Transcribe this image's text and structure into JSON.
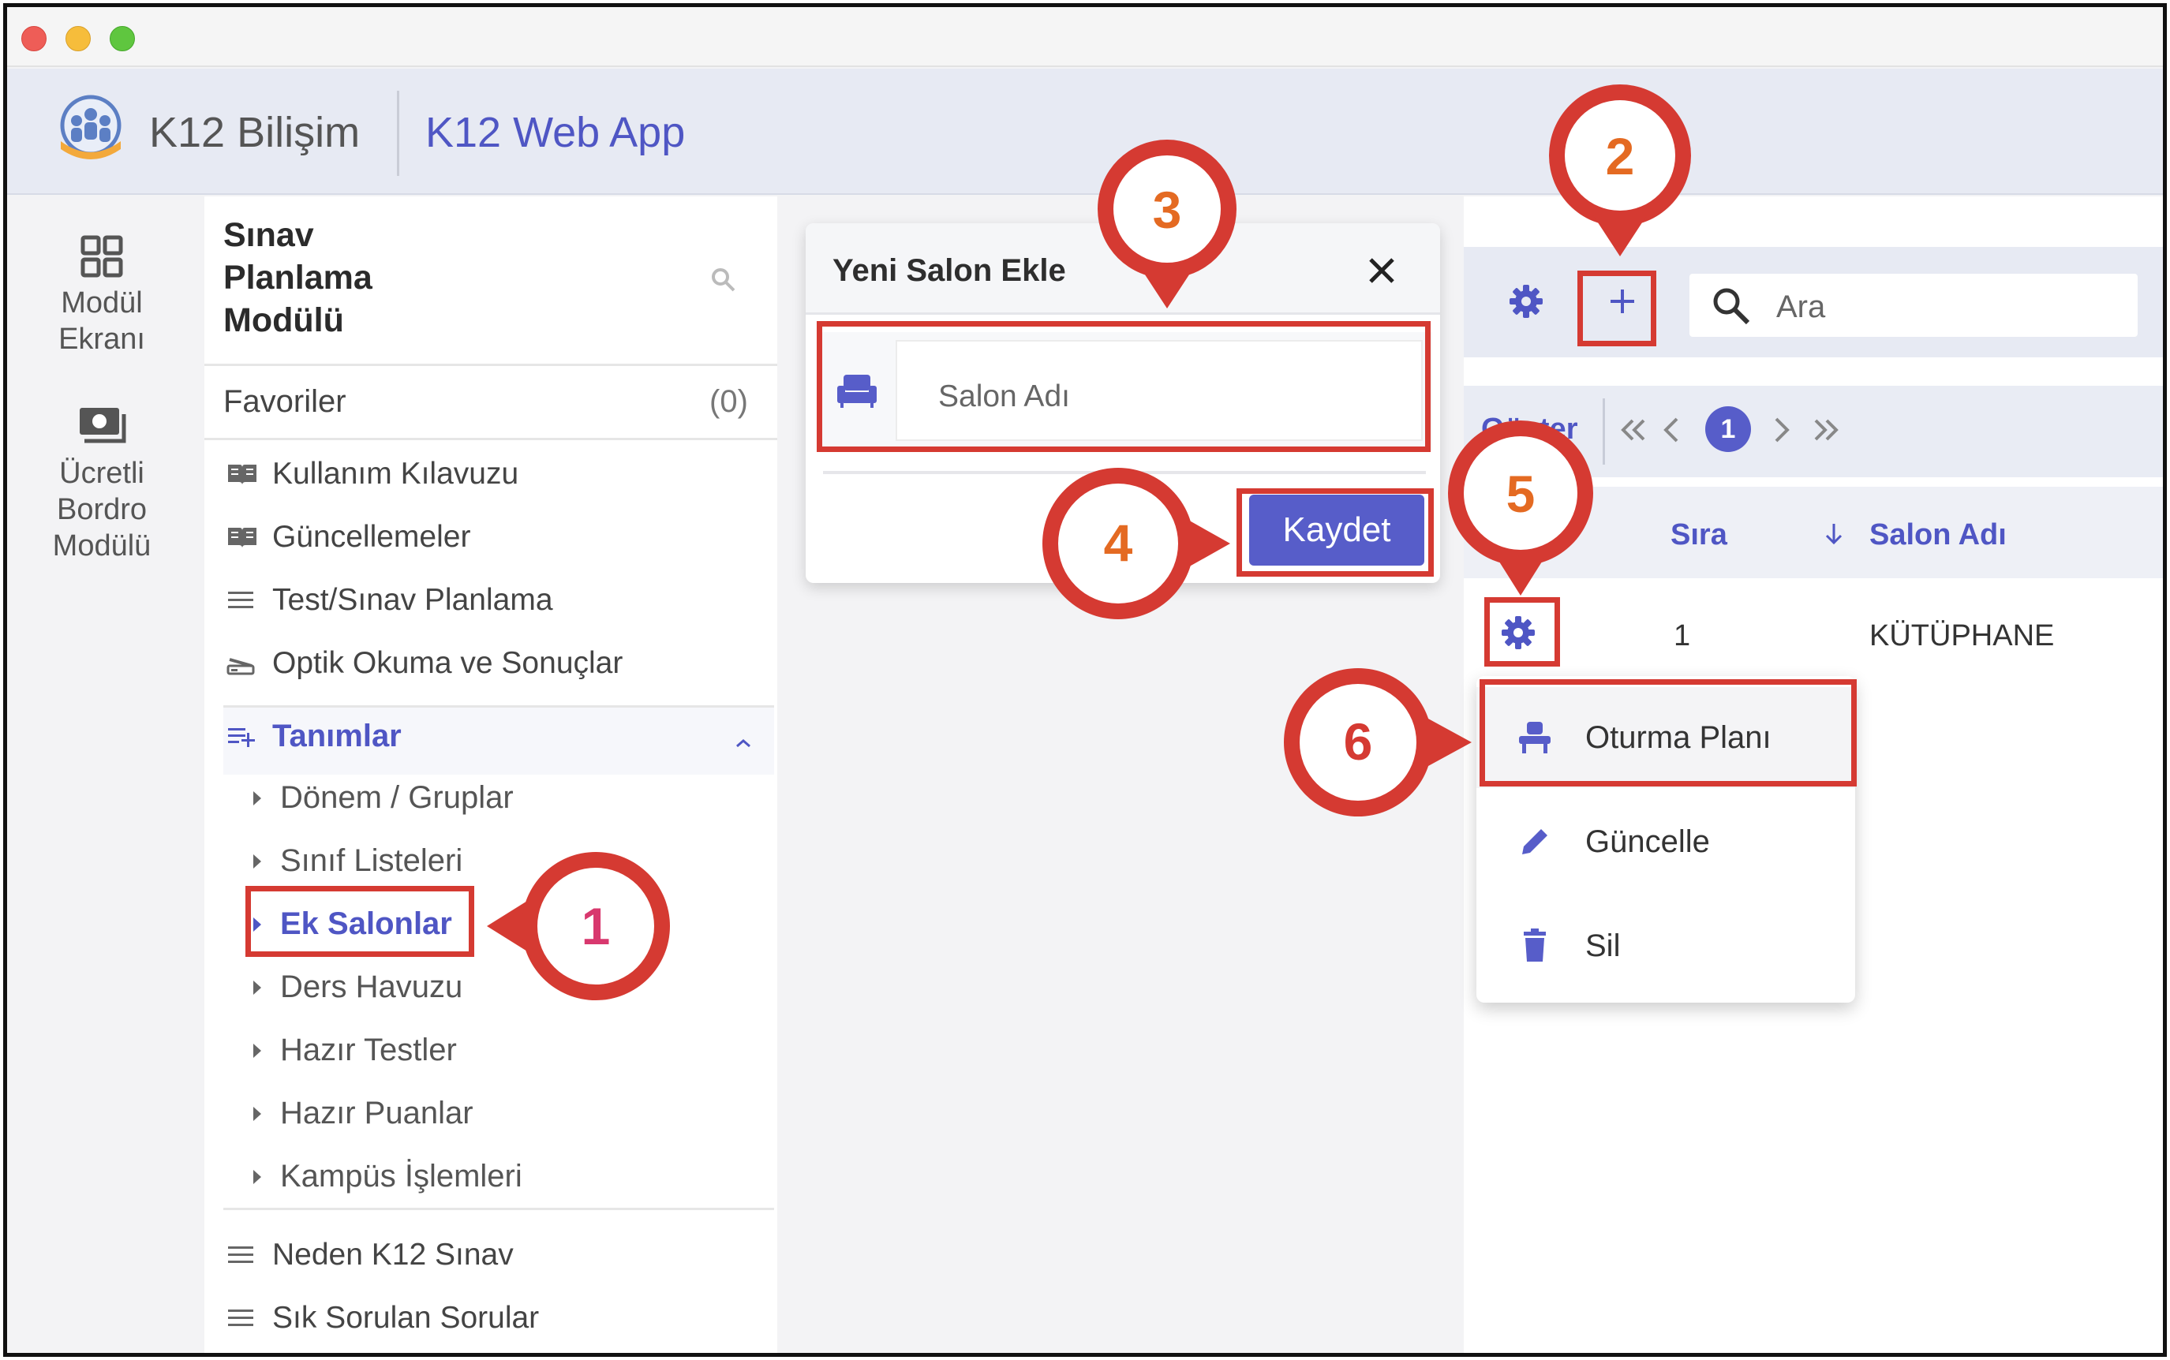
{
  "app": {
    "brand": "K12 Bilişim",
    "name": "K12 Web App"
  },
  "rail": {
    "items": [
      {
        "label_line1": "Modül",
        "label_line2": "Ekranı",
        "icon": "grid-icon"
      },
      {
        "label_line1": "Ücretli",
        "label_line2": "Bordro",
        "label_line3": "Modülü",
        "icon": "payroll-icon"
      }
    ]
  },
  "nav": {
    "title_line1": "Sınav",
    "title_line2": "Planlama",
    "title_line3": "Modülü",
    "favorites_label": "Favoriler",
    "favorites_count": "(0)",
    "items": [
      {
        "label": "Kullanım Kılavuzu",
        "icon": "book-icon"
      },
      {
        "label": "Güncellemeler",
        "icon": "book-icon"
      },
      {
        "label": "Test/Sınav Planlama",
        "icon": "menu-icon"
      },
      {
        "label": "Optik Okuma ve Sonuçlar",
        "icon": "scanner-icon"
      }
    ],
    "group": {
      "label": "Tanımlar",
      "icon": "playlist-add-icon",
      "children": [
        {
          "label": "Dönem / Gruplar"
        },
        {
          "label": "Sınıf Listeleri"
        },
        {
          "label": "Ek Salonlar",
          "active": true
        },
        {
          "label": "Ders Havuzu"
        },
        {
          "label": "Hazır Testler"
        },
        {
          "label": "Hazır Puanlar"
        },
        {
          "label": "Kampüs İşlemleri"
        }
      ]
    },
    "bottom_items": [
      {
        "label": "Neden K12 Sınav",
        "icon": "menu-icon"
      },
      {
        "label": "Sık Sorulan Sorular",
        "icon": "menu-icon"
      }
    ]
  },
  "dialog": {
    "title": "Yeni Salon Ekle",
    "field_placeholder": "Salon Adı",
    "save_label": "Kaydet"
  },
  "toolbar": {
    "search_placeholder": "Ara"
  },
  "pager": {
    "label": "Göster",
    "current_page": "1"
  },
  "table": {
    "columns": [
      "Sıra",
      "Salon Adı"
    ],
    "rows": [
      {
        "sira": "1",
        "salon_adi": "KÜTÜPHANE"
      }
    ]
  },
  "row_menu": {
    "items": [
      {
        "label": "Oturma Planı",
        "icon": "seat-icon"
      },
      {
        "label": "Güncelle",
        "icon": "pencil-icon"
      },
      {
        "label": "Sil",
        "icon": "trash-icon"
      }
    ]
  },
  "annotations": {
    "steps": [
      "1",
      "2",
      "3",
      "4",
      "5",
      "6"
    ],
    "color": "#d53a32",
    "accent": "#4f56c4"
  }
}
